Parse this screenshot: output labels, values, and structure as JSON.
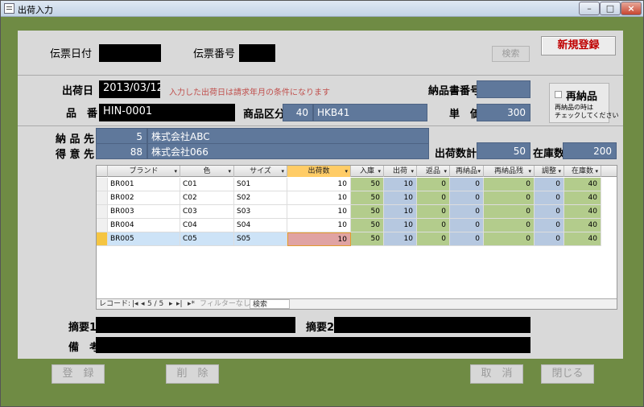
{
  "window": {
    "title": "出荷入力",
    "min": "–",
    "max": "□",
    "close": "×"
  },
  "header": {
    "slip_date_label": "伝票日付",
    "slip_no_label": "伝票番号",
    "search_button": "検索",
    "new_button": "新規登録"
  },
  "form": {
    "ship_date_label": "出荷日",
    "ship_date_value": "2013/03/12",
    "ship_date_note": "入力した出荷日は請求年月の条件になります",
    "delivery_slip_label": "納品書番号",
    "product_no_label": "品　番",
    "product_no_value": "HIN-0001",
    "category_label": "商品区分",
    "category_code": "40",
    "category_name": "HKB41",
    "unit_price_label": "単　価",
    "unit_price_value": "300",
    "delivery_to_label": "納 品 先",
    "delivery_to_code": "5",
    "delivery_to_name": "株式会社ABC",
    "customer_label": "得 意 先",
    "customer_code": "88",
    "customer_name": "株式会社066",
    "ship_count_label": "出荷数計",
    "ship_count_value": "50",
    "stock_label": "在庫数",
    "stock_value": "200",
    "redelivery_label": "再納品",
    "redelivery_note_line1": "再納品の時は",
    "redelivery_note_line2": "チェックしてください"
  },
  "grid": {
    "columns": [
      "ブランド",
      "色",
      "サイズ",
      "出荷数",
      "入庫",
      "出荷",
      "返品",
      "再納品",
      "再納品残",
      "調整",
      "在庫数"
    ],
    "rows": [
      [
        "BR001",
        "C01",
        "S01",
        "10",
        "50",
        "10",
        "0",
        "0",
        "0",
        "0",
        "40"
      ],
      [
        "BR002",
        "C02",
        "S02",
        "10",
        "50",
        "10",
        "0",
        "0",
        "0",
        "0",
        "40"
      ],
      [
        "BR003",
        "C03",
        "S03",
        "10",
        "50",
        "10",
        "0",
        "0",
        "0",
        "0",
        "40"
      ],
      [
        "BR004",
        "C04",
        "S04",
        "10",
        "50",
        "10",
        "0",
        "0",
        "0",
        "0",
        "40"
      ],
      [
        "BR005",
        "C05",
        "S05",
        "10",
        "50",
        "10",
        "0",
        "0",
        "0",
        "0",
        "40"
      ]
    ],
    "nav": {
      "record_label": "レコード:",
      "position": "5 / 5",
      "filter": "フィルターなし",
      "search": "検索"
    }
  },
  "footer": {
    "memo1_label": "摘要1",
    "memo2_label": "摘要2",
    "remarks_label": "備　考",
    "register_button": "登　録",
    "delete_button": "削　除",
    "cancel_button": "取　消",
    "close_button": "閉じる"
  },
  "colors": {
    "frame": "#6f8b44",
    "panel": "#d9d9d9",
    "field_blue": "#5f789b",
    "col_green": "#b3cc8c",
    "col_blue": "#b6c8e0",
    "selected_row": "#cde3f7",
    "active_cell": "#e0a3a3"
  }
}
